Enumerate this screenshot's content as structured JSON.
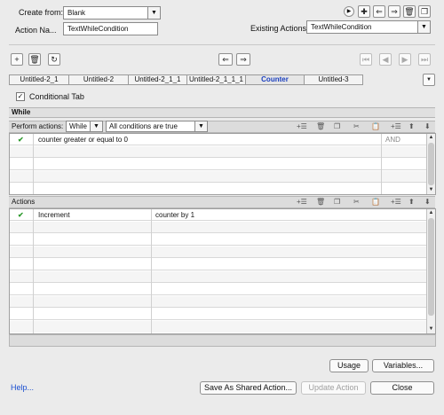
{
  "header": {
    "create_from_label": "Create from:",
    "create_from_value": "Blank",
    "action_name_label": "Action Na...",
    "action_name_value": "TextWhileCondition",
    "existing_actions_label": "Existing Actions:",
    "existing_actions_value": "TextWhileCondition"
  },
  "tabs": [
    {
      "label": "Untitled-2_1"
    },
    {
      "label": "Untitled-2"
    },
    {
      "label": "Untitled-2_1_1"
    },
    {
      "label": "Untitled-2_1_1_1"
    },
    {
      "label": "Counter"
    },
    {
      "label": "Untitled-3"
    }
  ],
  "conditional_tab_label": "Conditional Tab",
  "while_header": "While",
  "perform": {
    "label": "Perform actions:",
    "mode_value": "While",
    "conditions_value": "All conditions are true"
  },
  "conditions": [
    {
      "text": "counter   greater or equal to    0",
      "join": "AND"
    }
  ],
  "actions_header": "Actions",
  "actions": [
    {
      "name": "Increment",
      "params": "counter   by   1"
    }
  ],
  "buttons": {
    "usage": "Usage",
    "variables": "Variables...",
    "help": "Help...",
    "save_shared": "Save As Shared Action...",
    "update": "Update Action",
    "close": "Close"
  },
  "colors": {
    "active_tab": "#1a3fbf",
    "check": "#2e9a2e",
    "link": "#1a4fd0"
  }
}
